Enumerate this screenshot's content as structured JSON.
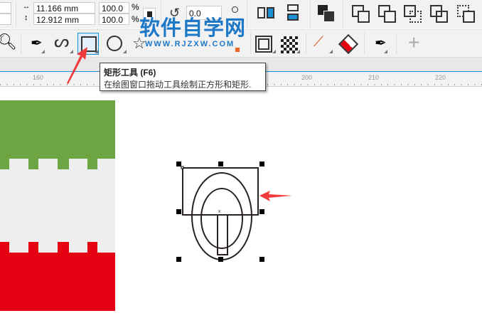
{
  "propertybar": {
    "width": "11.166 mm",
    "height": "12.912 mm",
    "scale_x": "100.0",
    "scale_y": "100.0",
    "pct": "%",
    "rotation": "0.0"
  },
  "watermark": {
    "title": "软件自学网",
    "url": "WWW.RJZXW.COM"
  },
  "toolbox": {
    "tools": [
      "zoom-tool",
      "pen-tool",
      "bspline-tool",
      "rectangle-tool",
      "ellipse-tool",
      "polygon-tool",
      "contour-tool",
      "transparency-tool",
      "eyedropper-tool",
      "fill-tool",
      "outline-pen-tool",
      "add-tool"
    ]
  },
  "tooltip": {
    "title": "矩形工具 (F6)",
    "desc": "在绘图窗口拖动工具绘制正方形和矩形."
  },
  "ruler": {
    "ticks": [
      "160",
      "200",
      "210",
      "220"
    ]
  },
  "colors": {
    "green": "#6ea543",
    "grey": "#eeeeee",
    "red": "#e50012",
    "accent": "#1e8fd6",
    "arrow": "#f23c3c"
  }
}
